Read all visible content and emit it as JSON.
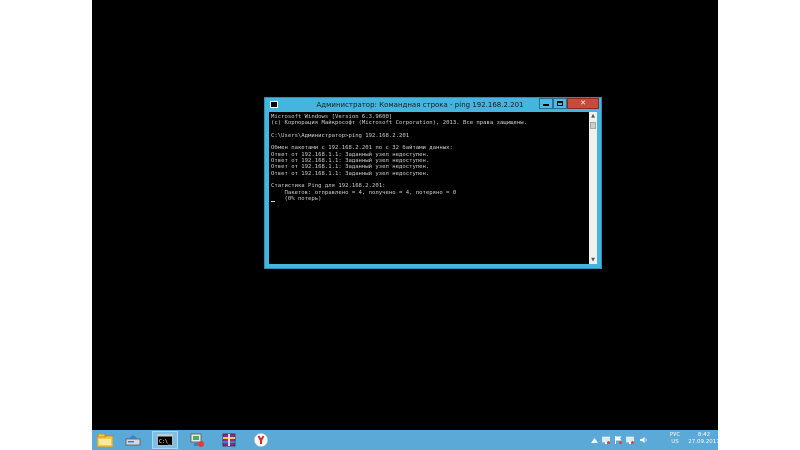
{
  "window": {
    "title": "Администратор: Командная строка - ping  192.168.2.201",
    "close_glyph": "✕"
  },
  "console": {
    "lines": [
      "Microsoft Windows [Version 6.3.9600]",
      "(c) Корпорация Майкрософт (Microsoft Corporation), 2013. Все права защищены.",
      "",
      "C:\\Users\\Администратор>ping 192.168.2.201",
      "",
      "Обмен пакетами с 192.168.2.201 по с 32 байтами данных:",
      "Ответ от 192.168.1.1: Заданный узел недоступен.",
      "Ответ от 192.168.1.1: Заданный узел недоступен.",
      "Ответ от 192.168.1.1: Заданный узел недоступен.",
      "Ответ от 192.168.1.1: Заданный узел недоступен.",
      "",
      "Статистика Ping для 192.168.2.201:",
      "    Пакетов: отправлено = 4, получено = 4, потеряно = 0",
      "    (0% потерь)"
    ]
  },
  "taskbar": {
    "items": [
      "file-explorer-icon",
      "server-manager-icon",
      "command-prompt-icon",
      "network-tool-icon",
      "archive-tool-icon",
      "yandex-browser-icon"
    ],
    "tray": {
      "icons": [
        "show-hidden-icons-icon",
        "network-icon",
        "flag-icon",
        "network-status-icon",
        "volume-icon"
      ],
      "language": "РУС",
      "layout": "US",
      "time": "8:42",
      "date": "27.09.2017"
    }
  }
}
